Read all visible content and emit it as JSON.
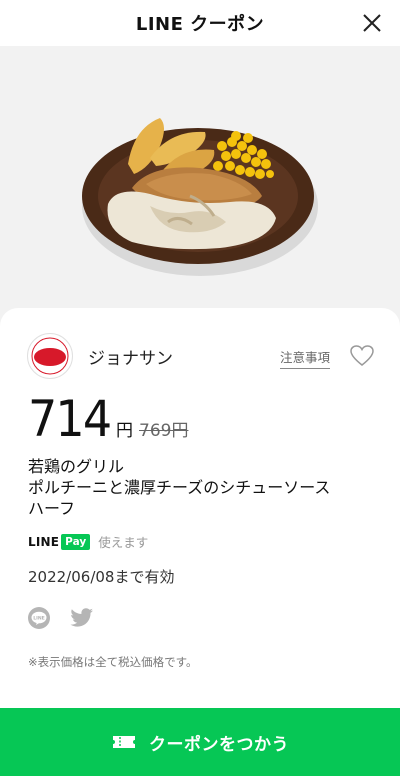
{
  "header": {
    "title": "LINE クーポン"
  },
  "brand": {
    "name": "ジョナサン",
    "logo_text": "ジョナサン"
  },
  "coupon": {
    "price": "714",
    "price_unit": "円",
    "original_price": "769円",
    "title_line1": "若鶏のグリル",
    "title_line2": "ポルチーニと濃厚チーズのシチューソース",
    "title_line3": "ハーフ",
    "pay_line": "LINE",
    "pay_badge": "Pay",
    "pay_usable": "使えます",
    "expiry": "2022/06/08まで有効",
    "tax_note": "※表示価格は全て税込価格です。",
    "notes_link": "注意事項"
  },
  "share": {
    "line_icon": "line-icon",
    "twitter_icon": "twitter-icon"
  },
  "cta": {
    "label": "クーポンをつかう",
    "icon": "ticket-icon"
  },
  "colors": {
    "brand_green": "#06c755",
    "logo_red": "#d7192a"
  }
}
